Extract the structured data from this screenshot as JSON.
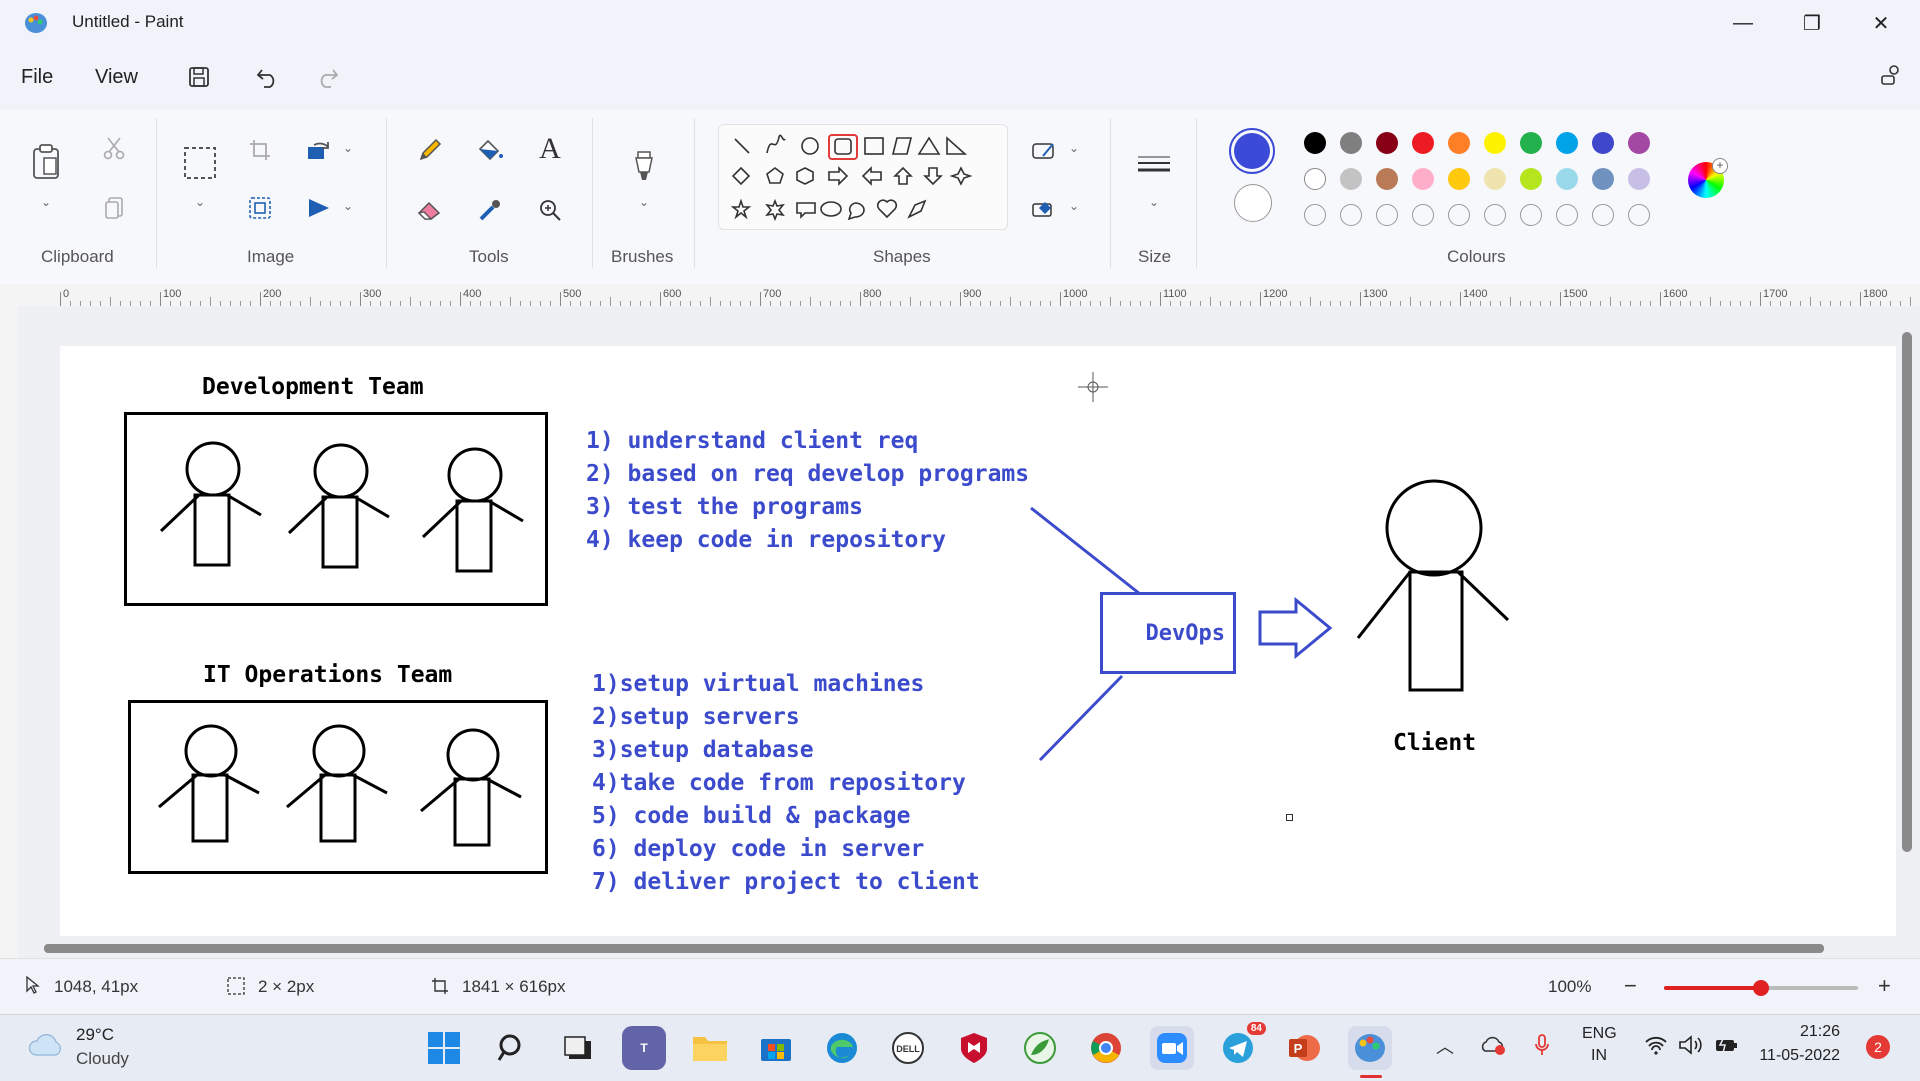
{
  "window": {
    "title": "Untitled - Paint",
    "minimize": "—",
    "restore": "❐",
    "close": "✕"
  },
  "menu": {
    "file": "File",
    "view": "View"
  },
  "ribbon": {
    "groups": {
      "clipboard": "Clipboard",
      "image": "Image",
      "tools": "Tools",
      "brushes": "Brushes",
      "shapes": "Shapes",
      "size": "Size",
      "colours": "Colours"
    },
    "primary_color": "#3b4bd8",
    "secondary_color": "#ffffff",
    "palette_row1": [
      "#000000",
      "#7f7f7f",
      "#880015",
      "#ed1c24",
      "#ff7f27",
      "#fff200",
      "#22b14c",
      "#00a2e8",
      "#3f48cc",
      "#a349a4"
    ],
    "palette_row2": [
      "#ffffff",
      "#c3c3c3",
      "#b97a57",
      "#ffaec9",
      "#ffc90e",
      "#efe4b0",
      "#b5e61d",
      "#99d9ea",
      "#7092be",
      "#c8bfe7"
    ]
  },
  "ruler": {
    "ticks": [
      "0",
      "100",
      "200",
      "300",
      "400",
      "500",
      "600",
      "700",
      "800",
      "900",
      "1000",
      "1100",
      "1200",
      "1300",
      "1400",
      "1500",
      "1600",
      "1700",
      "1800"
    ]
  },
  "drawing": {
    "dev_title": "Development Team",
    "ops_title": "IT Operations Team",
    "dev_steps": [
      "1) understand client req",
      "2) based on req develop programs",
      "3) test the programs",
      "4) keep code in repository"
    ],
    "ops_steps": [
      "1)setup virtual machines",
      "2)setup servers",
      "3)setup database",
      "4)take code from repository",
      "5) code build & package",
      "6) deploy code in server",
      "7) deliver project to client"
    ],
    "devops_label": "DevOps",
    "client_label": "Client"
  },
  "status": {
    "cursor": "1048, 41px",
    "selection": "2 × 2px",
    "canvas_size": "1841 × 616px",
    "zoom": "100%",
    "zoom_level_fraction": 0.5
  },
  "taskbar": {
    "weather_temp": "29°C",
    "weather_desc": "Cloudy",
    "lang1": "ENG",
    "lang2": "IN",
    "time": "21:26",
    "date": "11-05-2022",
    "notifications": "2",
    "telegram_badge": "84"
  }
}
